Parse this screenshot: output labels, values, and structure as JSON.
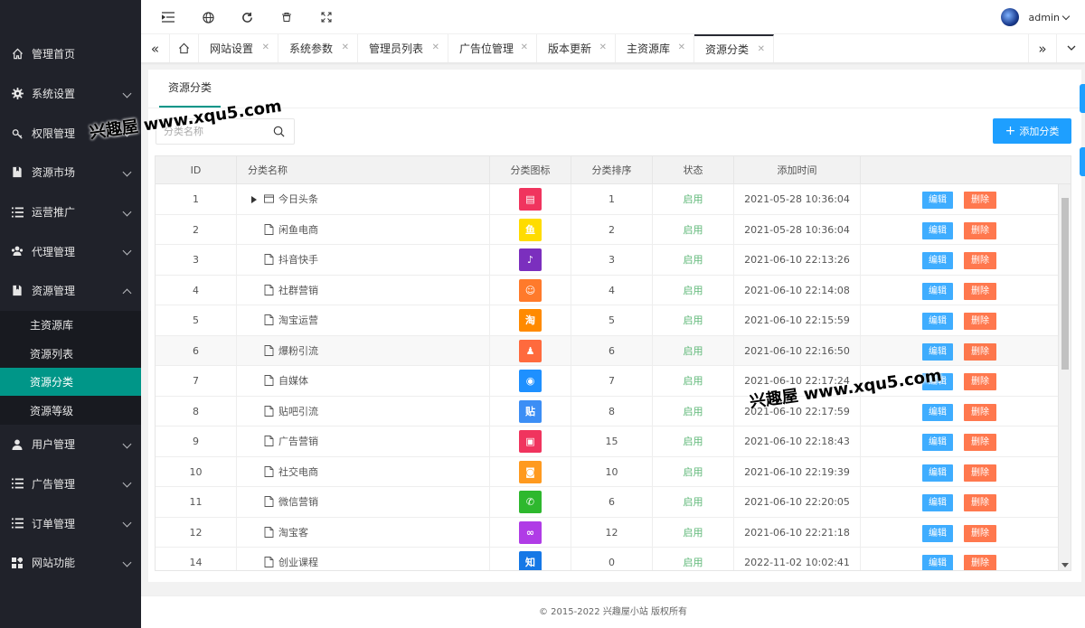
{
  "sidebar": {
    "items": [
      {
        "label": "管理首页",
        "icon": "home-icon",
        "chevron": false
      },
      {
        "label": "系统设置",
        "icon": "gear-icon",
        "chevron": true
      },
      {
        "label": "权限管理",
        "icon": "key-icon",
        "chevron": true
      },
      {
        "label": "资源市场",
        "icon": "book-icon",
        "chevron": true
      },
      {
        "label": "运营推广",
        "icon": "list-icon",
        "chevron": true
      },
      {
        "label": "代理管理",
        "icon": "users-icon",
        "chevron": true
      },
      {
        "label": "资源管理",
        "icon": "book-icon",
        "chevron": true,
        "expanded": true
      }
    ],
    "subitems": [
      "主资源库",
      "资源列表",
      "资源分类",
      "资源等级"
    ],
    "active_sub": "资源分类",
    "items_after": [
      {
        "label": "用户管理",
        "icon": "user-icon"
      },
      {
        "label": "广告管理",
        "icon": "list-icon"
      },
      {
        "label": "订单管理",
        "icon": "list-icon"
      },
      {
        "label": "网站功能",
        "icon": "grid-icon"
      }
    ]
  },
  "topbar": {
    "icons": [
      "menu-fold-icon",
      "globe-icon",
      "refresh-icon",
      "trash-icon",
      "fullscreen-icon"
    ],
    "username": "admin"
  },
  "tabs": [
    {
      "label": "网站设置"
    },
    {
      "label": "系统参数"
    },
    {
      "label": "管理员列表"
    },
    {
      "label": "广告位管理"
    },
    {
      "label": "版本更新"
    },
    {
      "label": "主资源库"
    },
    {
      "label": "资源分类",
      "active": true
    }
  ],
  "page": {
    "tab_title": "资源分类",
    "search_placeholder": "分类名称",
    "add_button": "添加分类"
  },
  "table": {
    "headers": {
      "id": "ID",
      "name": "分类名称",
      "icon": "分类图标",
      "sort": "分类排序",
      "status": "状态",
      "time": "添加时间"
    },
    "edit_label": "编辑",
    "delete_label": "删除",
    "rows": [
      {
        "id": "1",
        "name": "今日头条",
        "folder": true,
        "sort": "1",
        "status": "启用",
        "time": "2021-05-28 10:36:04",
        "icon_color": "#f0345e",
        "glyph": "▤"
      },
      {
        "id": "2",
        "name": "闲鱼电商",
        "sort": "2",
        "status": "启用",
        "time": "2021-05-28 10:36:04",
        "icon_color": "#ffdc00",
        "glyph": "鱼"
      },
      {
        "id": "3",
        "name": "抖音快手",
        "sort": "3",
        "status": "启用",
        "time": "2021-06-10 22:13:26",
        "icon_color": "#7b2fbe",
        "glyph": "♪"
      },
      {
        "id": "4",
        "name": "社群营销",
        "sort": "4",
        "status": "启用",
        "time": "2021-06-10 22:14:08",
        "icon_color": "#ff7a2b",
        "glyph": "☺"
      },
      {
        "id": "5",
        "name": "淘宝运营",
        "sort": "5",
        "status": "启用",
        "time": "2021-06-10 22:15:59",
        "icon_color": "#ff8a00",
        "glyph": "淘"
      },
      {
        "id": "6",
        "name": "爆粉引流",
        "sort": "6",
        "status": "启用",
        "time": "2021-06-10 22:16:50",
        "icon_color": "#ff6a3d",
        "glyph": "♟"
      },
      {
        "id": "7",
        "name": "自媒体",
        "sort": "7",
        "status": "启用",
        "time": "2021-06-10 22:17:24",
        "icon_color": "#1e90ff",
        "glyph": "◉"
      },
      {
        "id": "8",
        "name": "贴吧引流",
        "sort": "8",
        "status": "启用",
        "time": "2021-06-10 22:17:59",
        "icon_color": "#3c8ef5",
        "glyph": "贴"
      },
      {
        "id": "9",
        "name": "广告营销",
        "sort": "15",
        "status": "启用",
        "time": "2021-06-10 22:18:43",
        "icon_color": "#f0345e",
        "glyph": "▣"
      },
      {
        "id": "10",
        "name": "社交电商",
        "sort": "10",
        "status": "启用",
        "time": "2021-06-10 22:19:39",
        "icon_color": "#ff9a1f",
        "glyph": "◙"
      },
      {
        "id": "11",
        "name": "微信营销",
        "sort": "6",
        "status": "启用",
        "time": "2021-06-10 22:20:05",
        "icon_color": "#2eb82e",
        "glyph": "✆"
      },
      {
        "id": "12",
        "name": "淘宝客",
        "sort": "12",
        "status": "启用",
        "time": "2021-06-10 22:21:18",
        "icon_color": "#b03ce6",
        "glyph": "∞"
      },
      {
        "id": "14",
        "name": "创业课程",
        "sort": "0",
        "status": "启用",
        "time": "2022-11-02 10:02:41",
        "icon_color": "#1678e6",
        "glyph": "知"
      }
    ]
  },
  "footer": "© 2015-2022 兴趣屋小站 版权所有",
  "watermark": "兴趣屋 www.xqu5.com"
}
